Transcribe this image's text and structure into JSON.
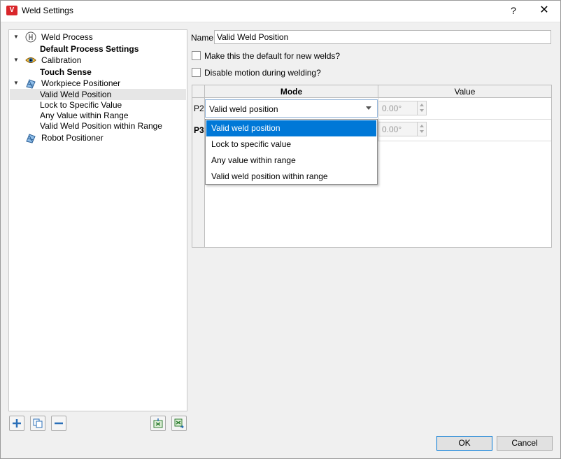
{
  "window": {
    "title": "Weld Settings",
    "help_label": "?",
    "close_label": "✕"
  },
  "tree": {
    "items": [
      {
        "label": "Weld Process",
        "icon": "weld-process-icon"
      },
      {
        "label": "Default Process Settings"
      },
      {
        "label": "Calibration",
        "icon": "eye-icon"
      },
      {
        "label": "Touch Sense"
      },
      {
        "label": "Workpiece Positioner",
        "icon": "positioner-icon"
      },
      {
        "label": "Valid Weld Position"
      },
      {
        "label": "Lock to Specific Value"
      },
      {
        "label": "Any Value within Range"
      },
      {
        "label": "Valid Weld Position within Range"
      },
      {
        "label": "Robot Positioner",
        "icon": "positioner-icon"
      }
    ]
  },
  "form": {
    "name_label": "Name",
    "name_value": "Valid Weld Position",
    "default_checkbox_label": "Make this the default for new welds?",
    "disable_motion_label": "Disable motion during welding?"
  },
  "table": {
    "header_mode": "Mode",
    "header_value": "Value",
    "rows": [
      {
        "id": "P2",
        "mode": "Valid weld position",
        "value": "0.00°"
      },
      {
        "id": "P3",
        "value": "0.00°"
      }
    ]
  },
  "dropdown": {
    "options": [
      "Valid weld position",
      "Lock to specific value",
      "Any value within range",
      "Valid weld position within range"
    ],
    "selected": "Valid weld position"
  },
  "buttons": {
    "ok": "OK",
    "cancel": "Cancel"
  },
  "colors": {
    "accent": "#0078d7",
    "app_icon": "#d9262b"
  }
}
